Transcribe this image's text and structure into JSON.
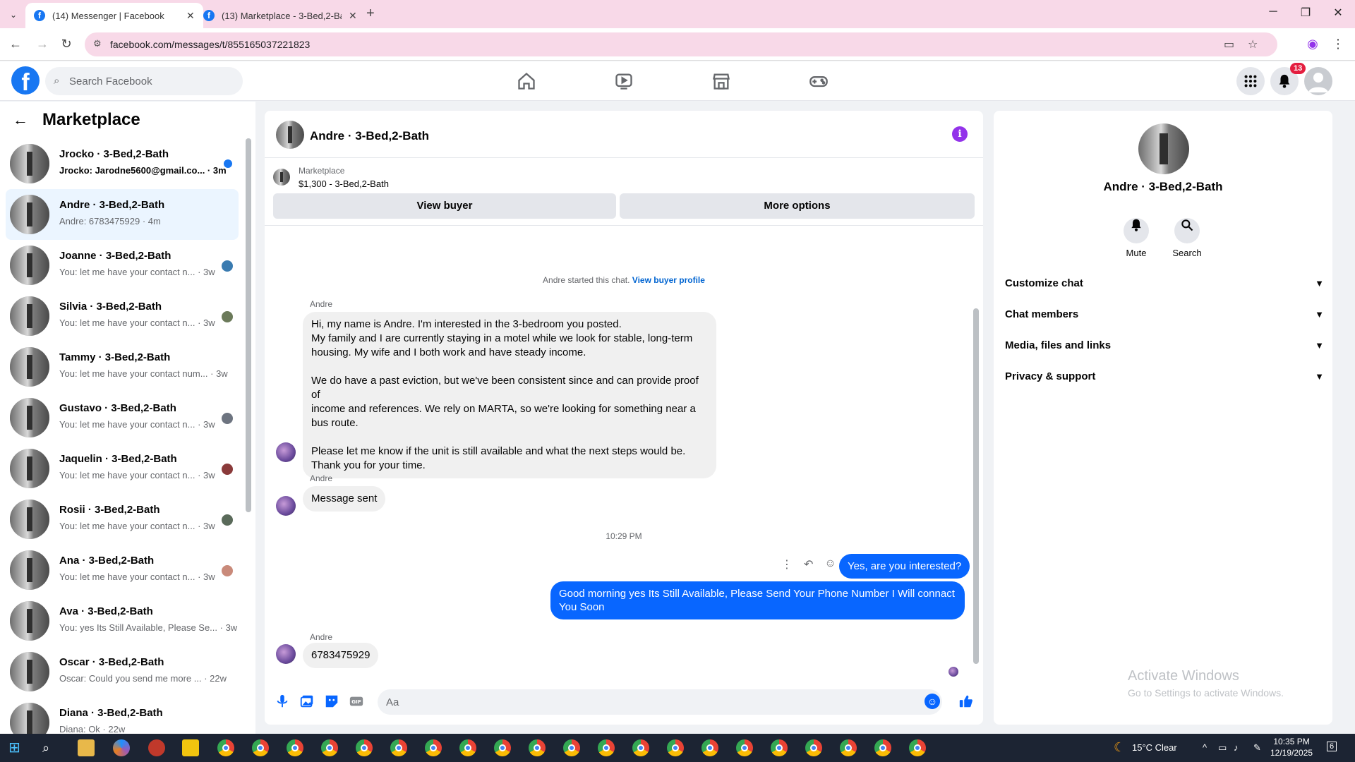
{
  "browser": {
    "tabs": [
      {
        "title": "(14) Messenger | Facebook",
        "active": true
      },
      {
        "title": "(13) Marketplace - 3-Bed,2-Bath",
        "active": false
      }
    ],
    "url": "facebook.com/messages/t/855165037221823"
  },
  "header": {
    "search_placeholder": "Search Facebook",
    "notification_count": "13"
  },
  "left_panel": {
    "title": "Marketplace",
    "conversations": [
      {
        "name": "Jrocko · 3-Bed,2-Bath",
        "snippet": "Jrocko: Jarodne5600@gmail.co... · 3m",
        "unread": true
      },
      {
        "name": "Andre · 3-Bed,2-Bath",
        "snippet": "Andre: 6783475929 · 4m",
        "selected": true
      },
      {
        "name": "Joanne · 3-Bed,2-Bath",
        "snippet": "You: let me have your contact n... · 3w"
      },
      {
        "name": "Silvia · 3-Bed,2-Bath",
        "snippet": "You: let me have your contact n... · 3w"
      },
      {
        "name": "Tammy · 3-Bed,2-Bath",
        "snippet": "You: let me have your contact num... · 3w"
      },
      {
        "name": "Gustavo · 3-Bed,2-Bath",
        "snippet": "You: let me have your contact n... · 3w"
      },
      {
        "name": "Jaquelin · 3-Bed,2-Bath",
        "snippet": "You: let me have your contact n... · 3w"
      },
      {
        "name": "Rosii · 3-Bed,2-Bath",
        "snippet": "You: let me have your contact n... · 3w"
      },
      {
        "name": "Ana · 3-Bed,2-Bath",
        "snippet": "You: let me have your contact n... · 3w"
      },
      {
        "name": "Ava · 3-Bed,2-Bath",
        "snippet": "You: yes Its Still Available, Please Se... · 3w"
      },
      {
        "name": "Oscar · 3-Bed,2-Bath",
        "snippet": "Oscar: Could you send me more ... · 22w"
      },
      {
        "name": "Diana · 3-Bed,2-Bath",
        "snippet": "Diana: Ok · 22w"
      }
    ]
  },
  "chat": {
    "title": "Andre · 3-Bed,2-Bath",
    "listing_category": "Marketplace",
    "listing_title": "$1,300 - 3-Bed,2-Bath",
    "view_buyer": "View buyer",
    "more_options": "More options",
    "started_text": "Andre started this chat.",
    "view_buyer_profile": "View buyer profile",
    "sender_name": "Andre",
    "message1_lines": [
      "Hi, my name is Andre. I'm interested in the 3-bedroom you posted.",
      "My family and I are currently staying in a motel while we look for stable, long-term",
      "housing. My wife and I both work and have steady income.",
      "",
      "We do have a past eviction, but we've been consistent since and can provide proof of",
      "income and references. We rely on MARTA, so we're looking for something near a",
      "bus route.",
      "",
      "Please let me know if the unit is still available and what the next steps would be.",
      "Thank you for your time."
    ],
    "message2": "Message sent",
    "timestamp": "10:29 PM",
    "reply1": "Yes, are you interested?",
    "reply2": "Good morning yes  Its Still Available, Please Send Your Phone Number I Will connact You Soon",
    "message3": "6783475929",
    "composer_placeholder": "Aa"
  },
  "right_panel": {
    "name": "Andre · 3-Bed,2-Bath",
    "mute": "Mute",
    "search": "Search",
    "sections": [
      "Customize chat",
      "Chat members",
      "Media, files and links",
      "Privacy & support"
    ],
    "watermark_title": "Activate Windows",
    "watermark_sub": "Go to Settings to activate Windows."
  },
  "taskbar": {
    "weather": "15°C  Clear",
    "time": "10:35 PM",
    "date": "12/19/2025",
    "notification_count": "6"
  },
  "colors": {
    "accent": "#0866ff",
    "fb_blue": "#1877f2",
    "tab_pink": "#f8d9e8"
  }
}
